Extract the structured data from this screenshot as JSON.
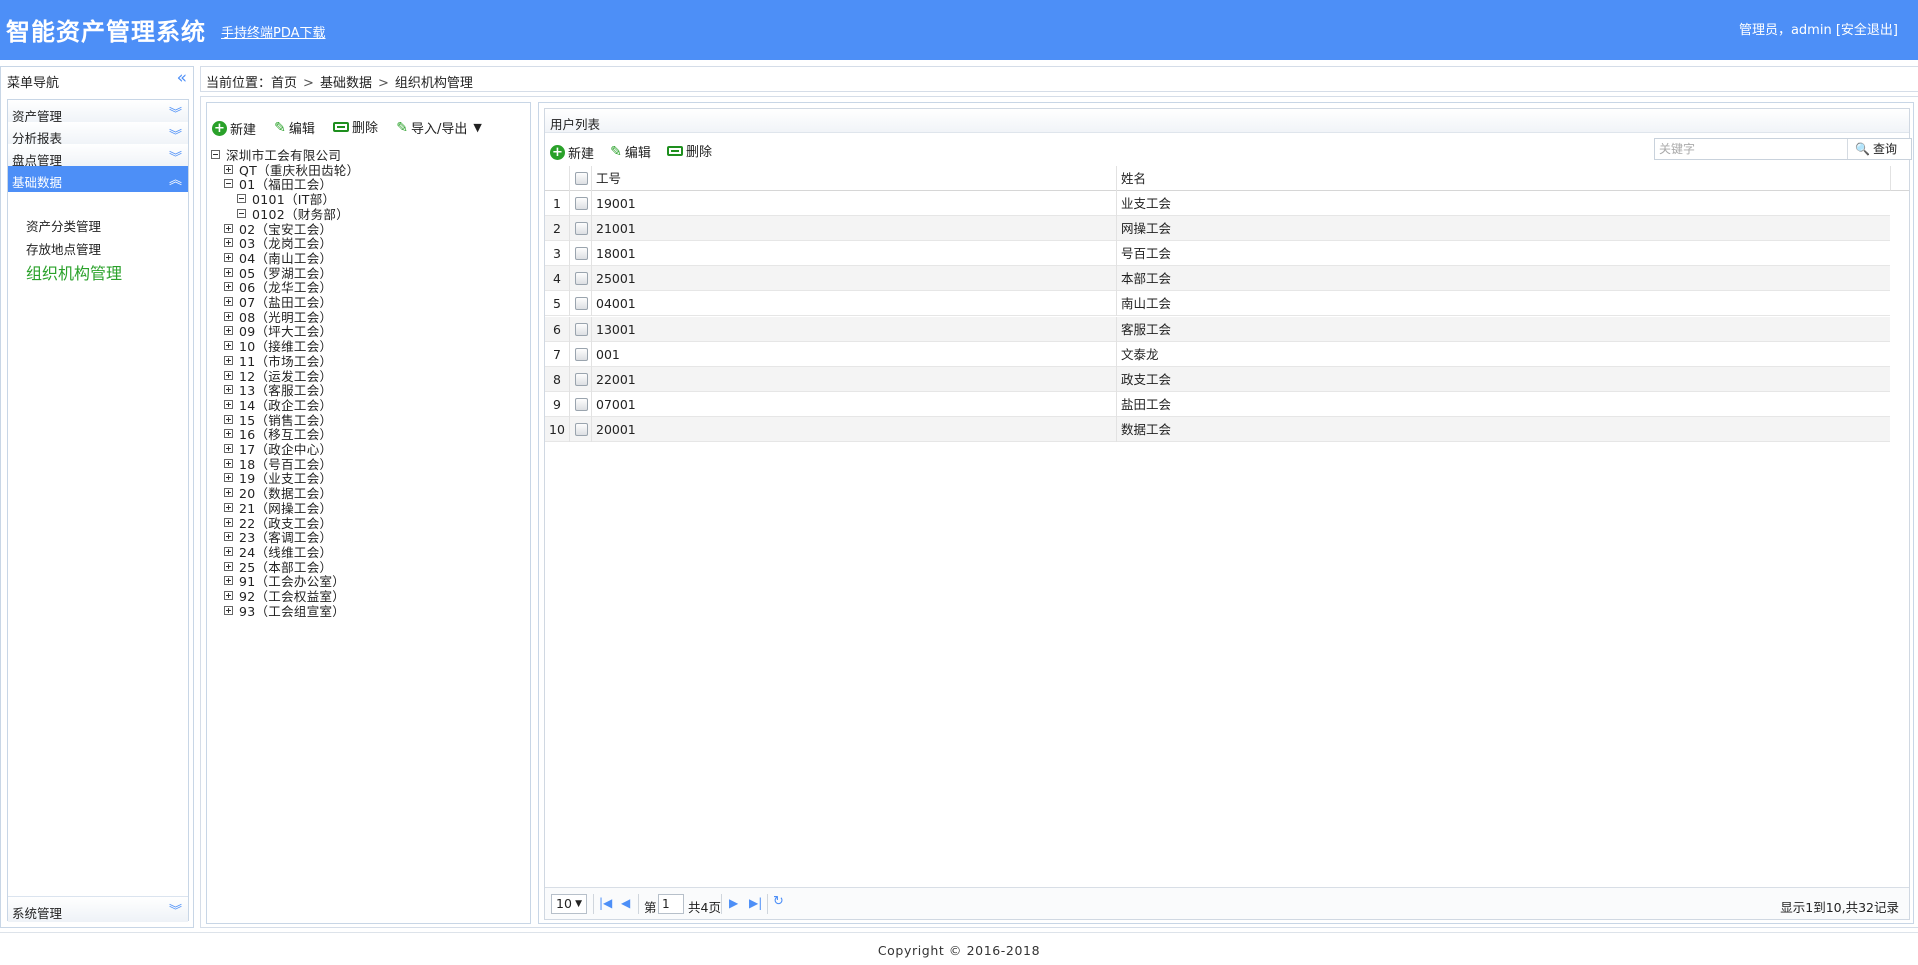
{
  "header": {
    "title": "智能资产管理系统",
    "pda_link": "手持终端PDA下载",
    "user": "管理员，admin",
    "logout": "[安全退出]"
  },
  "sidebar": {
    "title": "菜单导航",
    "sections": [
      {
        "label": "资产管理",
        "active": false
      },
      {
        "label": "分析报表",
        "active": false
      },
      {
        "label": "盘点管理",
        "active": false
      },
      {
        "label": "基础数据",
        "active": true
      }
    ],
    "sub_items": [
      "资产分类管理",
      "存放地点管理",
      "组织机构管理"
    ],
    "current_sub": "组织机构管理",
    "bottom_section": "系统管理"
  },
  "breadcrumb": {
    "prefix": "当前位置：",
    "items": [
      "首页",
      "基础数据",
      "组织机构管理"
    ],
    "separator": ">"
  },
  "tree_toolbar": {
    "new": "新建",
    "edit": "编辑",
    "delete": "删除",
    "import_export": "导入/导出"
  },
  "tree": [
    {
      "label": "深圳市工会有限公司",
      "level": 0,
      "expanded": true
    },
    {
      "label": "QT（重庆秋田齿轮）",
      "level": 1,
      "expanded": false
    },
    {
      "label": "01（福田工会）",
      "level": 1,
      "expanded": true
    },
    {
      "label": "0101（IT部）",
      "level": 2,
      "expanded": true
    },
    {
      "label": "0102（财务部）",
      "level": 2,
      "expanded": true
    },
    {
      "label": "02（宝安工会）",
      "level": 1,
      "expanded": false
    },
    {
      "label": "03（龙岗工会）",
      "level": 1,
      "expanded": false
    },
    {
      "label": "04（南山工会）",
      "level": 1,
      "expanded": false
    },
    {
      "label": "05（罗湖工会）",
      "level": 1,
      "expanded": false
    },
    {
      "label": "06（龙华工会）",
      "level": 1,
      "expanded": false
    },
    {
      "label": "07（盐田工会）",
      "level": 1,
      "expanded": false
    },
    {
      "label": "08（光明工会）",
      "level": 1,
      "expanded": false
    },
    {
      "label": "09（坪大工会）",
      "level": 1,
      "expanded": false
    },
    {
      "label": "10（接维工会）",
      "level": 1,
      "expanded": false
    },
    {
      "label": "11（市场工会）",
      "level": 1,
      "expanded": false
    },
    {
      "label": "12（运发工会）",
      "level": 1,
      "expanded": false
    },
    {
      "label": "13（客服工会）",
      "level": 1,
      "expanded": false
    },
    {
      "label": "14（政企工会）",
      "level": 1,
      "expanded": false
    },
    {
      "label": "15（销售工会）",
      "level": 1,
      "expanded": false
    },
    {
      "label": "16（移互工会）",
      "level": 1,
      "expanded": false
    },
    {
      "label": "17（政企中心）",
      "level": 1,
      "expanded": false
    },
    {
      "label": "18（号百工会）",
      "level": 1,
      "expanded": false
    },
    {
      "label": "19（业支工会）",
      "level": 1,
      "expanded": false
    },
    {
      "label": "20（数据工会）",
      "level": 1,
      "expanded": false
    },
    {
      "label": "21（网操工会）",
      "level": 1,
      "expanded": false
    },
    {
      "label": "22（政支工会）",
      "level": 1,
      "expanded": false
    },
    {
      "label": "23（客调工会）",
      "level": 1,
      "expanded": false
    },
    {
      "label": "24（线维工会）",
      "level": 1,
      "expanded": false
    },
    {
      "label": "25（本部工会）",
      "level": 1,
      "expanded": false
    },
    {
      "label": "91（工会办公室）",
      "level": 1,
      "expanded": false
    },
    {
      "label": "92（工会权益室）",
      "level": 1,
      "expanded": false
    },
    {
      "label": "93（工会组宣室）",
      "level": 1,
      "expanded": false
    }
  ],
  "grid": {
    "title": "用户列表",
    "toolbar": {
      "new": "新建",
      "edit": "编辑",
      "delete": "删除"
    },
    "search_placeholder": "关键字",
    "search_button": "查询",
    "columns": [
      "工号",
      "姓名"
    ],
    "rows": [
      {
        "n": "1",
        "id": "19001",
        "name": "业支工会"
      },
      {
        "n": "2",
        "id": "21001",
        "name": "网操工会"
      },
      {
        "n": "3",
        "id": "18001",
        "name": "号百工会"
      },
      {
        "n": "4",
        "id": "25001",
        "name": "本部工会"
      },
      {
        "n": "5",
        "id": "04001",
        "name": "南山工会"
      },
      {
        "n": "6",
        "id": "13001",
        "name": "客服工会"
      },
      {
        "n": "7",
        "id": "001",
        "name": "文泰龙"
      },
      {
        "n": "8",
        "id": "22001",
        "name": "政支工会"
      },
      {
        "n": "9",
        "id": "07001",
        "name": "盐田工会"
      },
      {
        "n": "10",
        "id": "20001",
        "name": "数据工会"
      }
    ]
  },
  "pager": {
    "page_size": "10",
    "page_label": "第",
    "current_page": "1",
    "total_pages": "共4页",
    "summary": "显示1到10,共32记录"
  },
  "footer": "Copyright © 2016-2018",
  "colors": {
    "accent": "#4d8ff7",
    "green": "#2aa12a",
    "text": "#222222"
  }
}
